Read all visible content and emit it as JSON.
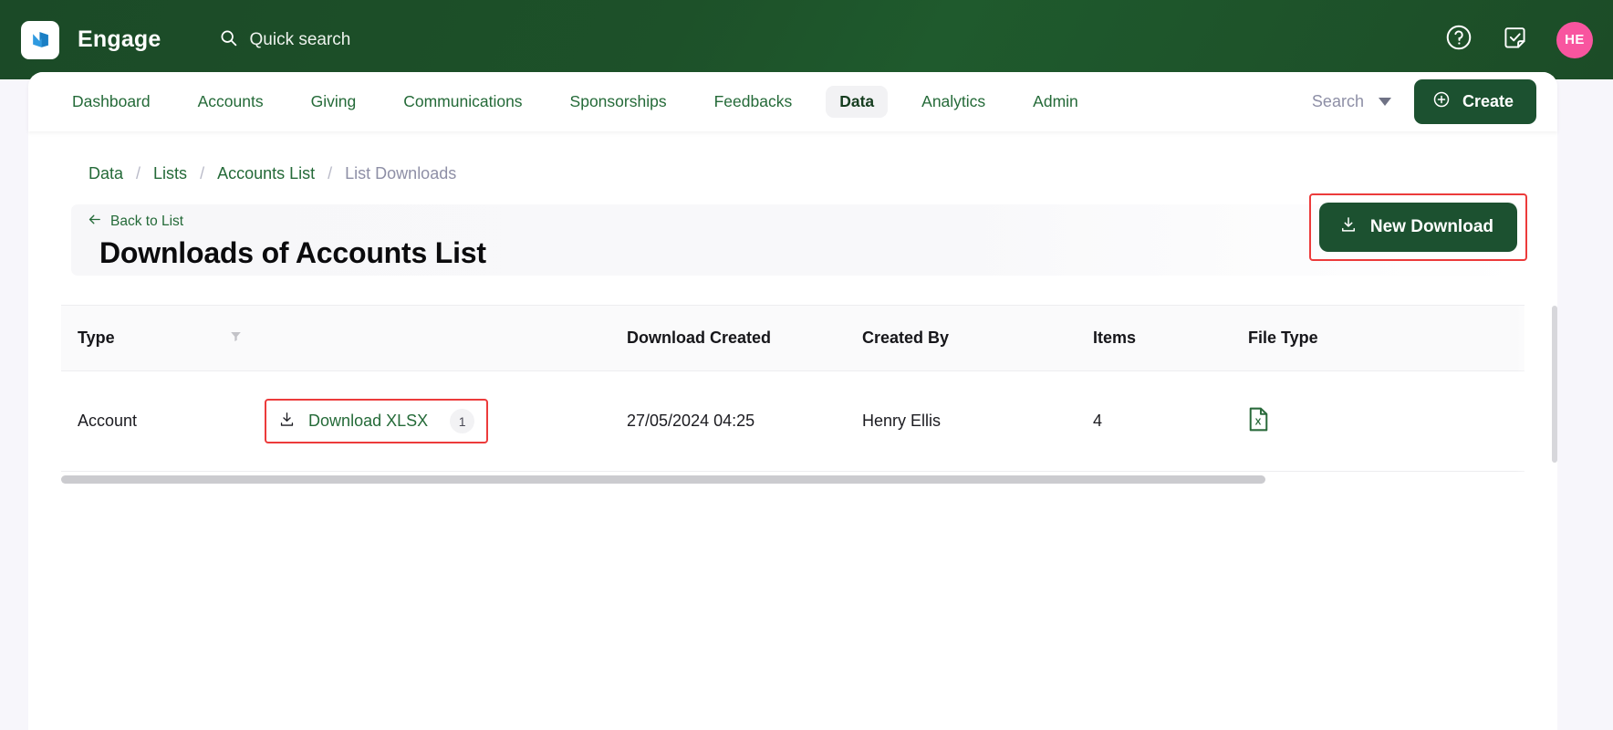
{
  "topbar": {
    "brand": "Engage",
    "logo_icon": "engage-logo-icon",
    "search_icon": "search-icon",
    "quick_search_label": "Quick search",
    "help_icon": "help-circle-icon",
    "tasks_icon": "checklist-note-icon",
    "avatar_initials": "HE",
    "avatar_color": "#f8559f",
    "background_color": "#1d4f2a"
  },
  "nav": {
    "items": [
      {
        "label": "Dashboard",
        "active": false
      },
      {
        "label": "Accounts",
        "active": false
      },
      {
        "label": "Giving",
        "active": false
      },
      {
        "label": "Communications",
        "active": false
      },
      {
        "label": "Sponsorships",
        "active": false
      },
      {
        "label": "Feedbacks",
        "active": false
      },
      {
        "label": "Data",
        "active": true
      },
      {
        "label": "Analytics",
        "active": false
      },
      {
        "label": "Admin",
        "active": false
      }
    ],
    "search_label": "Search",
    "search_caret_icon": "chevron-down-icon",
    "create_label": "Create",
    "create_icon": "plus-circle-icon",
    "create_color": "#1c5130"
  },
  "breadcrumb": {
    "items": [
      "Data",
      "Lists",
      "Accounts List",
      "List Downloads"
    ],
    "separator": "/",
    "current_index": 3
  },
  "page": {
    "back_link": "Back to List",
    "back_icon": "arrow-left-icon",
    "title": "Downloads of Accounts List",
    "new_download_label": "New Download",
    "new_download_icon": "download-icon",
    "highlight_color": "#ec3b3b"
  },
  "table": {
    "columns": [
      "Type",
      "Download Created",
      "Created By",
      "Items",
      "File Type"
    ],
    "filter_icon": "filter-funnel-icon",
    "rows": [
      {
        "type": "Account",
        "download_label": "Download XLSX",
        "download_icon": "download-icon",
        "download_count": "1",
        "download_created": "27/05/2024 04:25",
        "created_by": "Henry Ellis",
        "items": "4",
        "file_type_icon": "excel-file-icon"
      }
    ]
  }
}
